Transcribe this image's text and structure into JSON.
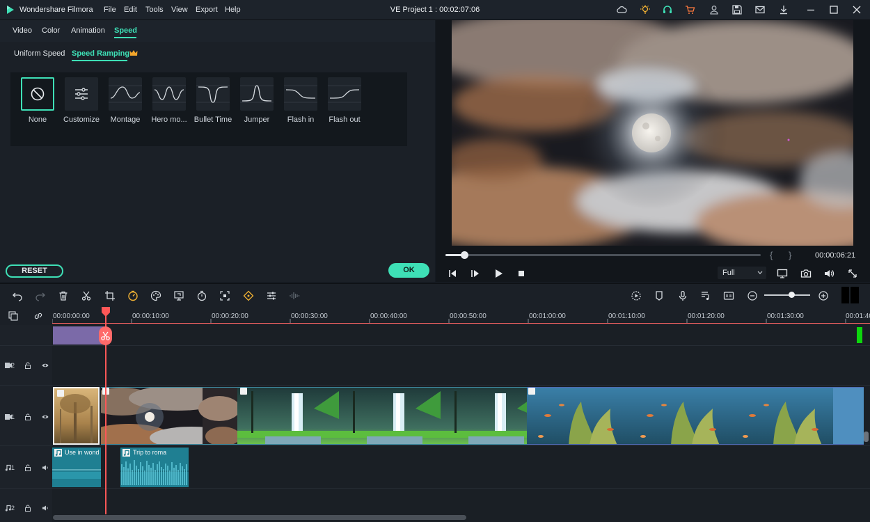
{
  "app": {
    "name": "Wondershare Filmora",
    "project_title": "VE Project 1 : 00:02:07:06"
  },
  "menu": [
    "File",
    "Edit",
    "Tools",
    "View",
    "Export",
    "Help"
  ],
  "title_icons": [
    "cloud-icon",
    "bulb-icon",
    "headset-icon",
    "cart-icon",
    "user-icon",
    "save-icon",
    "mail-icon",
    "download-icon",
    "minimize-icon",
    "maximize-icon",
    "close-icon"
  ],
  "editor_tabs": [
    "Video",
    "Color",
    "Animation",
    "Speed"
  ],
  "speed_subtabs": [
    "Uniform Speed",
    "Speed Ramping"
  ],
  "presets": [
    "None",
    "Customize",
    "Montage",
    "Hero mo...",
    "Bullet Time",
    "Jumper",
    "Flash in",
    "Flash out"
  ],
  "buttons": {
    "reset": "RESET",
    "ok": "OK"
  },
  "preview": {
    "timecode": "00:00:06:21",
    "brace_left": "{",
    "brace_right": "}",
    "quality": "Full",
    "progress_fraction": 0.06
  },
  "ruler_ticks": [
    "00:00:00:00",
    "00:00:10:00",
    "00:00:20:00",
    "00:00:30:00",
    "00:00:40:00",
    "00:00:50:00",
    "00:01:00:00",
    "00:01:10:00",
    "00:01:20:00",
    "00:01:30:00",
    "00:01:40"
  ],
  "tracks": {
    "video2": "2",
    "video1": "1",
    "audio1": "1",
    "audio2": "2"
  },
  "audio_clips": [
    "Use in wond",
    "Trip to roma"
  ],
  "colors": {
    "accent": "#3ee0b6",
    "playhead": "#ff5757",
    "audio_clip": "#1f7f92"
  }
}
